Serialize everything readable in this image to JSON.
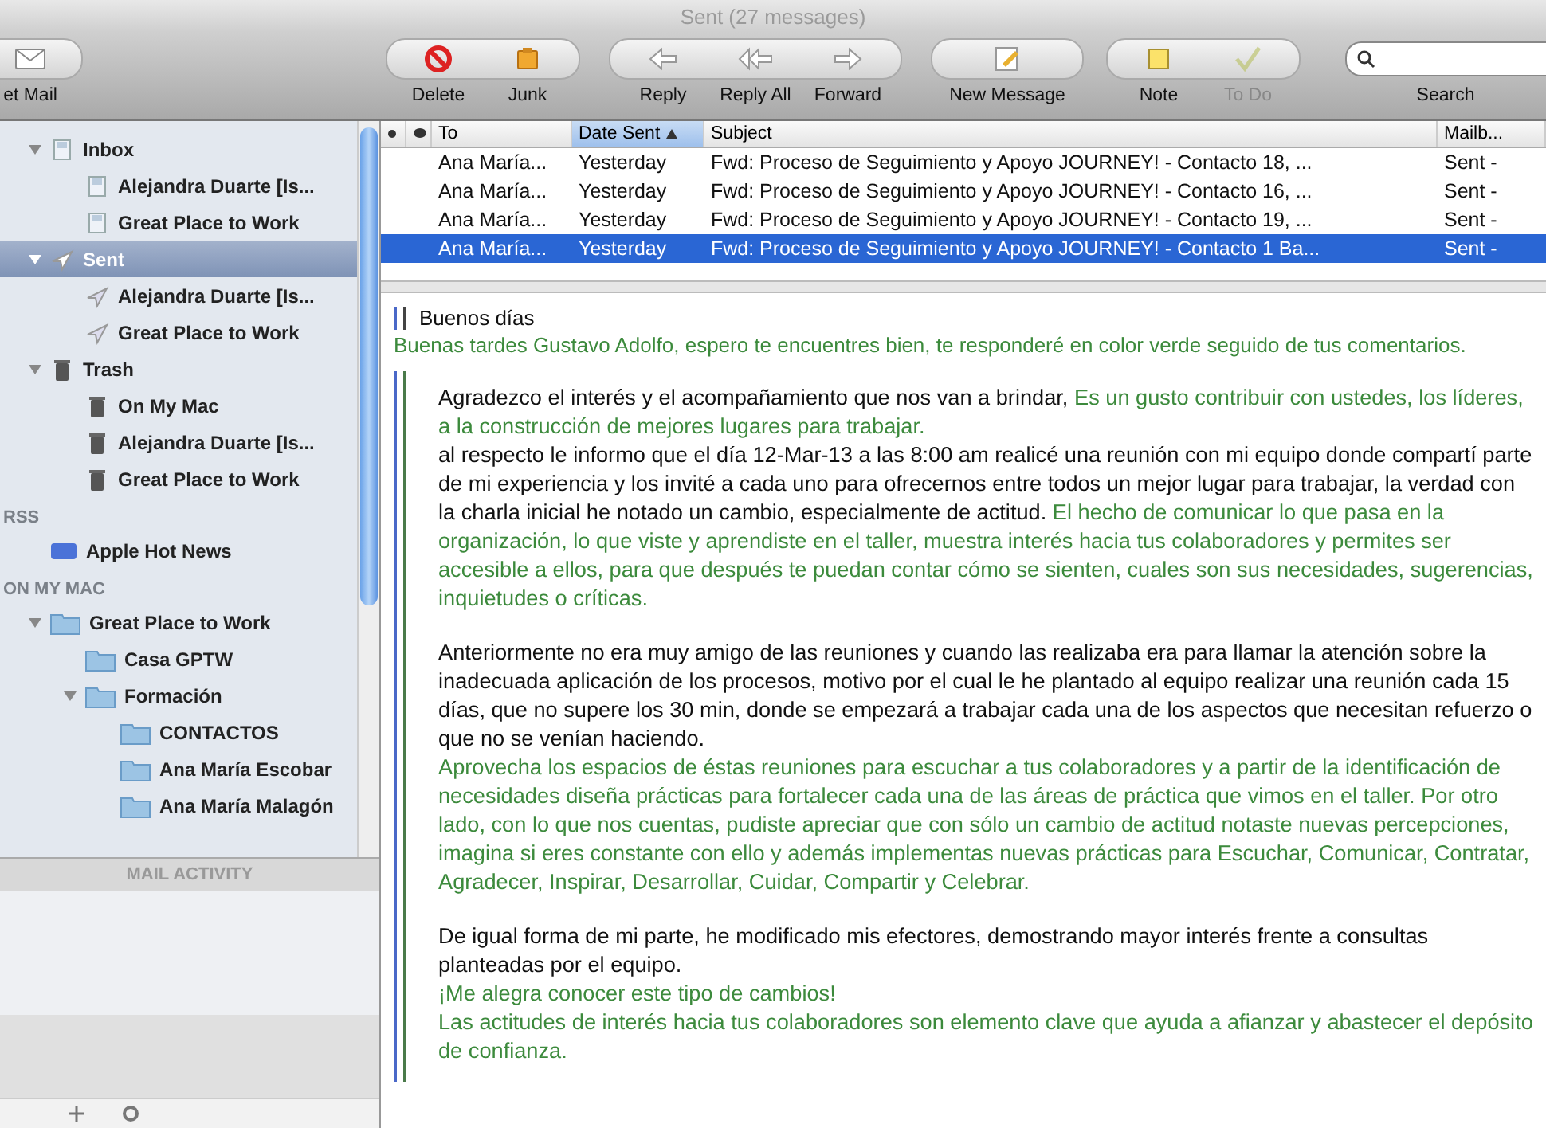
{
  "window": {
    "title": "Sent (27 messages)"
  },
  "toolbar": {
    "groups": [
      {
        "buttons": [
          {
            "label": "et Mail",
            "disabled": false
          }
        ]
      },
      {
        "buttons": [
          {
            "label": "Delete",
            "disabled": false
          },
          {
            "label": "Junk",
            "disabled": false
          }
        ]
      },
      {
        "buttons": [
          {
            "label": "Reply",
            "disabled": false
          },
          {
            "label": "Reply All",
            "disabled": false
          },
          {
            "label": "Forward",
            "disabled": false
          }
        ]
      },
      {
        "buttons": [
          {
            "label": "New Message",
            "disabled": false
          }
        ]
      },
      {
        "buttons": [
          {
            "label": "Note",
            "disabled": false
          },
          {
            "label": "To Do",
            "disabled": true
          }
        ]
      }
    ],
    "search": {
      "label": "Search"
    }
  },
  "sidebar": {
    "sections": [
      {
        "items": [
          {
            "label": "Inbox",
            "kind": "inbox",
            "expanded": true,
            "selected": false,
            "children": [
              {
                "label": "Alejandra Duarte [Is...",
                "kind": "inbox",
                "selected": false
              },
              {
                "label": "Great Place to Work",
                "kind": "inbox",
                "selected": false
              }
            ]
          },
          {
            "label": "Sent",
            "kind": "sent",
            "expanded": true,
            "selected": true,
            "children": [
              {
                "label": "Alejandra Duarte [Is...",
                "kind": "sent",
                "selected": false
              },
              {
                "label": "Great Place to Work",
                "kind": "sent",
                "selected": false
              }
            ]
          },
          {
            "label": "Trash",
            "kind": "trash",
            "expanded": true,
            "selected": false,
            "children": [
              {
                "label": "On My Mac",
                "kind": "trash",
                "selected": false
              },
              {
                "label": "Alejandra Duarte [Is...",
                "kind": "trash",
                "selected": false
              },
              {
                "label": "Great Place to Work",
                "kind": "trash",
                "selected": false
              }
            ]
          }
        ]
      },
      {
        "heading": "RSS",
        "items": [
          {
            "label": "Apple Hot News",
            "kind": "rss",
            "selected": false
          }
        ]
      },
      {
        "heading": "ON MY MAC",
        "items": [
          {
            "label": "Great Place to Work",
            "kind": "folder",
            "expanded": true,
            "selected": false,
            "children": [
              {
                "label": "Casa GPTW",
                "kind": "folder",
                "selected": false
              },
              {
                "label": "Formación",
                "kind": "folder",
                "expanded": true,
                "selected": false,
                "children": [
                  {
                    "label": "CONTACTOS",
                    "kind": "folder",
                    "selected": false
                  },
                  {
                    "label": "Ana María Escobar",
                    "kind": "folder",
                    "selected": false
                  },
                  {
                    "label": "Ana María Malagón",
                    "kind": "folder",
                    "selected": false
                  }
                ]
              }
            ]
          }
        ]
      }
    ],
    "activity": {
      "title": "MAIL ACTIVITY"
    }
  },
  "message_list": {
    "columns": [
      {
        "kind": "dot",
        "selected": false
      },
      {
        "kind": "bubble",
        "selected": false
      },
      {
        "kind": "text",
        "label": "To",
        "selected": false
      },
      {
        "kind": "text",
        "label": "Date Sent",
        "selected": true
      },
      {
        "kind": "text",
        "label": "Subject",
        "selected": false
      },
      {
        "kind": "text",
        "label": "Mailb...",
        "selected": false
      }
    ],
    "rows": [
      {
        "to": "Ana María...",
        "date": "Yesterday",
        "subject": "Fwd: Proceso de Seguimiento y Apoyo JOURNEY! - Contacto 18, ...",
        "mailbox": "Sent -",
        "selected": false
      },
      {
        "to": "Ana María...",
        "date": "Yesterday",
        "subject": "Fwd: Proceso de Seguimiento y Apoyo JOURNEY! - Contacto 16, ...",
        "mailbox": "Sent -",
        "selected": false
      },
      {
        "to": "Ana María...",
        "date": "Yesterday",
        "subject": "Fwd: Proceso de Seguimiento y Apoyo JOURNEY! - Contacto 19, ...",
        "mailbox": "Sent -",
        "selected": false
      },
      {
        "to": "Ana María...",
        "date": "Yesterday",
        "subject": "Fwd: Proceso de Seguimiento y Apoyo JOURNEY! - Contacto 1 Ba...",
        "mailbox": "Sent -",
        "selected": true
      }
    ]
  },
  "message": {
    "greeting": "Buenos días",
    "intro": "Buenas tardes Gustavo Adolfo, espero te encuentres bien, te responderé en color verde seguido de tus comentarios.",
    "blocks": [
      [
        [
          {
            "kind": "original",
            "text": "Agradezco el interés y el acompañamiento que nos van a brindar, "
          },
          {
            "kind": "reply",
            "text": "Es un gusto contribuir con ustedes, los líderes, a la construcción de mejores lugares para trabajar."
          }
        ],
        [
          {
            "kind": "original",
            "text": " al respecto le informo que el día 12-Mar-13 a las 8:00 am realicé una reunión con mi equipo donde compartí parte de mi experiencia y los invité a cada uno para ofrecernos entre todos un mejor lugar para trabajar, la verdad con la charla inicial he notado un cambio, especialmente de actitud."
          },
          {
            "kind": "reply",
            "text": " El hecho de comunicar lo que pasa en la organización, lo que viste y aprendiste en el taller, muestra interés hacia tus colaboradores y permites ser accesible a ellos, para que después te puedan contar cómo se sienten, cuales son sus necesidades, sugerencias, inquietudes o críticas."
          }
        ]
      ],
      [
        [
          {
            "kind": "original",
            "text": "Anteriormente no era muy amigo de las reuniones y cuando las realizaba era para llamar la atención sobre la inadecuada aplicación de los procesos, motivo por el cual le he plantado al equipo realizar una reunión cada 15 días, que no supere los 30 min, donde se empezará a trabajar cada una de los aspectos que necesitan refuerzo o que no se venían haciendo."
          }
        ],
        [
          {
            "kind": "reply",
            "text": "Aprovecha los espacios de éstas reuniones para escuchar a tus colaboradores y a partir de la identificación de necesidades diseña prácticas para fortalecer cada una de las áreas de práctica que vimos en el taller. Por otro lado, con lo que nos cuentas, pudiste apreciar que con sólo un cambio de actitud notaste nuevas percepciones, imagina si eres constante con ello y además implementas nuevas prácticas para Escuchar, Comunicar, Contratar, Agradecer, Inspirar, Desarrollar, Cuidar, Compartir y Celebrar."
          }
        ]
      ],
      [
        [
          {
            "kind": "original",
            "text": "De igual forma de mi parte, he modificado mis efectores, demostrando mayor interés frente a consultas planteadas por el equipo."
          }
        ],
        [
          {
            "kind": "reply",
            "text": "¡Me alegra conocer este tipo de cambios!"
          }
        ],
        [
          {
            "kind": "reply",
            "text": "Las actitudes de interés hacia tus colaboradores son elemento clave que ayuda a afianzar y abastecer el depósito de confianza."
          }
        ]
      ]
    ]
  }
}
